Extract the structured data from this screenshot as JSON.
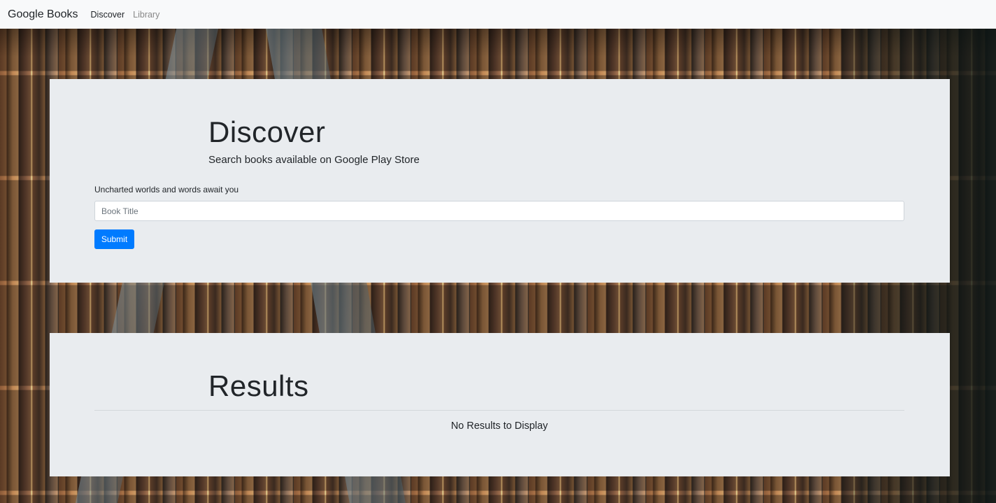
{
  "navbar": {
    "brand": "Google Books",
    "links": [
      {
        "label": "Discover",
        "active": true
      },
      {
        "label": "Library",
        "active": false
      }
    ]
  },
  "discover": {
    "title": "Discover",
    "subtitle": "Search books available on Google Play Store",
    "form": {
      "label": "Uncharted worlds and words await you",
      "input_placeholder": "Book Title",
      "input_value": "",
      "submit_label": "Submit"
    }
  },
  "results": {
    "title": "Results",
    "empty_message": "No Results to Display"
  },
  "colors": {
    "navbar_bg": "#f8f9fa",
    "panel_bg": "#e9ecef",
    "primary": "#007bff",
    "muted_link": "#888888"
  },
  "background": {
    "image": "bookshelf-background"
  }
}
